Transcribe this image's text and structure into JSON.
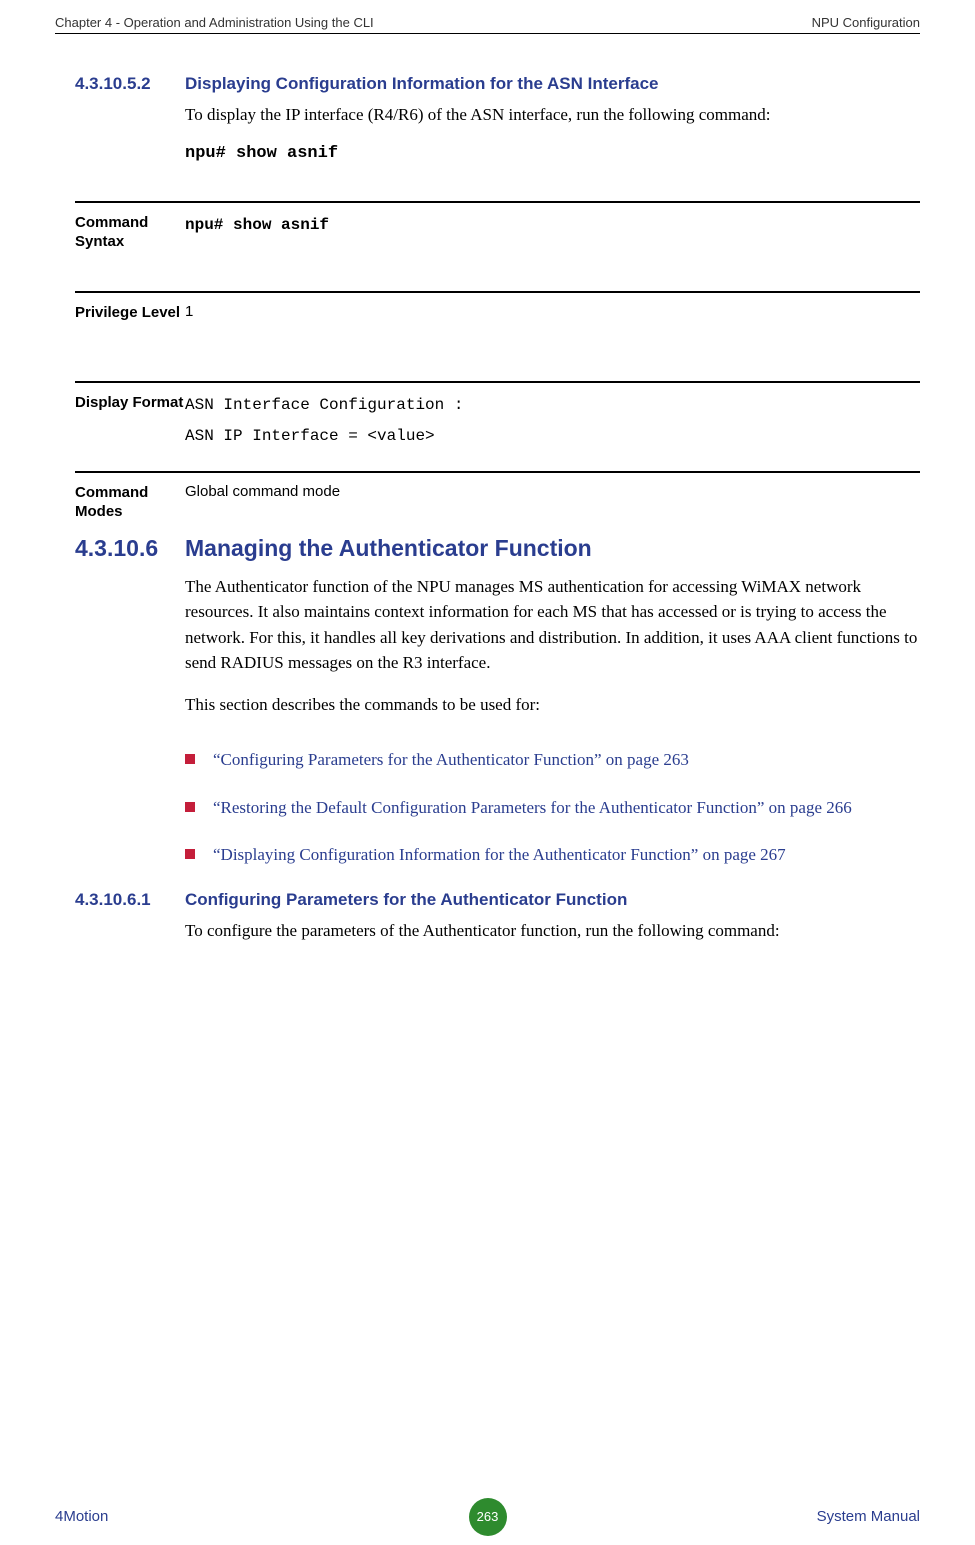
{
  "header": {
    "left": "Chapter 4 - Operation and Administration Using the CLI",
    "right": "NPU Configuration"
  },
  "sections": [
    {
      "number": "4.3.10.5.2",
      "title": "Displaying Configuration Information for the ASN Interface",
      "intro": "To display the IP interface (R4/R6) of the ASN interface, run the following command:",
      "command": "npu# show asnif"
    }
  ],
  "definitions": [
    {
      "label": "Command Syntax",
      "value": "npu# show asnif",
      "bold": true
    },
    {
      "label": "Privilege Level",
      "value": "1",
      "plain": true
    },
    {
      "label": "Display Format",
      "line1": "ASN Interface Configuration :",
      "line2": "ASN IP Interface = <value>"
    },
    {
      "label": "Command Modes",
      "value": "Global command mode",
      "plain": true
    }
  ],
  "main_section": {
    "number": "4.3.10.6",
    "title": "Managing the Authenticator Function",
    "para1": "The Authenticator function of the NPU manages MS authentication for accessing WiMAX network resources. It also maintains context information for each MS that has accessed or is trying to access the network. For this, it handles all key derivations and distribution. In addition, it uses AAA client functions to send RADIUS messages on the R3 interface.",
    "para2": "This section describes the commands to be used for:"
  },
  "bullets": [
    "“Configuring Parameters for the Authenticator Function” on page 263",
    "“Restoring the Default Configuration Parameters for the Authenticator Function” on page 266",
    "“Displaying Configuration Information for the Authenticator Function” on page 267"
  ],
  "sub_section": {
    "number": "4.3.10.6.1",
    "title": "Configuring Parameters for the Authenticator Function",
    "intro": "To configure the parameters of the Authenticator function, run the following command:"
  },
  "footer": {
    "left": "4Motion",
    "page": "263",
    "right": "System Manual"
  }
}
